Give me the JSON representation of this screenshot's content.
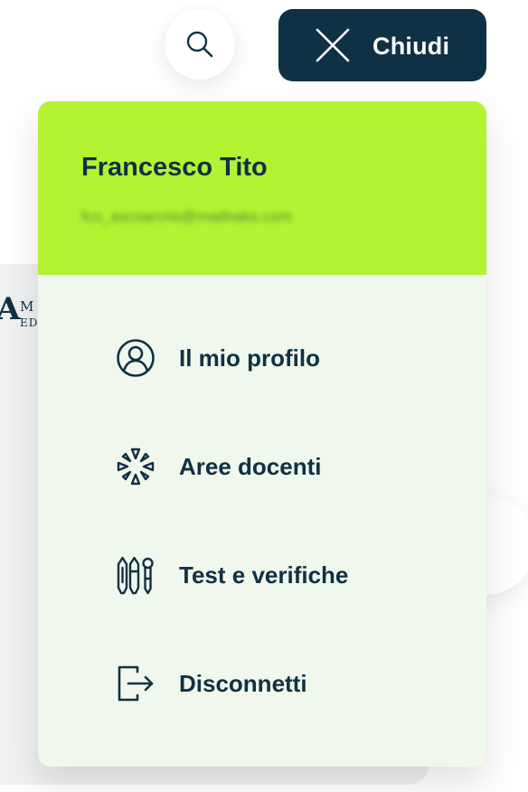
{
  "header": {
    "close_label": "Chiudi"
  },
  "background": {
    "logo_letter": "A",
    "logo_text_top": "M",
    "logo_text_bottom": "ED"
  },
  "user": {
    "name": "Francesco Tito",
    "email": "fco_ascoarcrio@mailhako.com"
  },
  "menu": {
    "items": [
      {
        "label": "Il mio profilo",
        "icon": "user-profile-icon"
      },
      {
        "label": "Aree docenti",
        "icon": "teacher-area-icon"
      },
      {
        "label": "Test e verifiche",
        "icon": "tests-icon"
      },
      {
        "label": "Disconnetti",
        "icon": "logout-icon"
      }
    ]
  },
  "colors": {
    "navy": "#0f3144",
    "lime": "#b5f232",
    "menu_bg": "#f0f7ec"
  }
}
